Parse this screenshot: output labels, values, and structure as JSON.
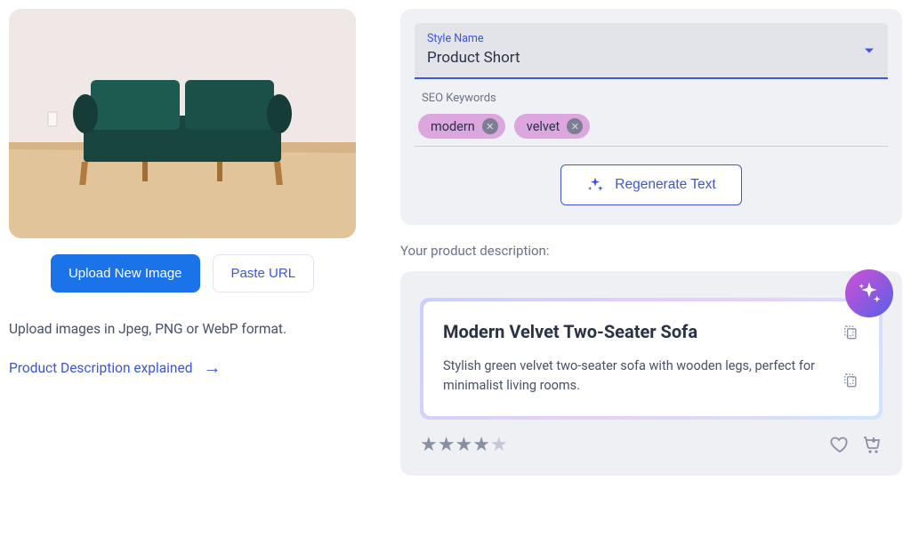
{
  "left": {
    "upload_button": "Upload New Image",
    "paste_url_button": "Paste URL",
    "help_text": "Upload images in Jpeg, PNG or WebP format.",
    "link_text": "Product Description explained"
  },
  "config": {
    "style_label": "Style Name",
    "style_value": "Product Short",
    "keywords_label": "SEO Keywords",
    "keywords": [
      "modern",
      "velvet"
    ],
    "regen_button": "Regenerate Text"
  },
  "result": {
    "section_label": "Your product description:",
    "title": "Modern Velvet Two-Seater Sofa",
    "body": "Stylish green velvet two-seater sofa with wooden legs, perfect for minimalist living rooms.",
    "rating": 4
  }
}
